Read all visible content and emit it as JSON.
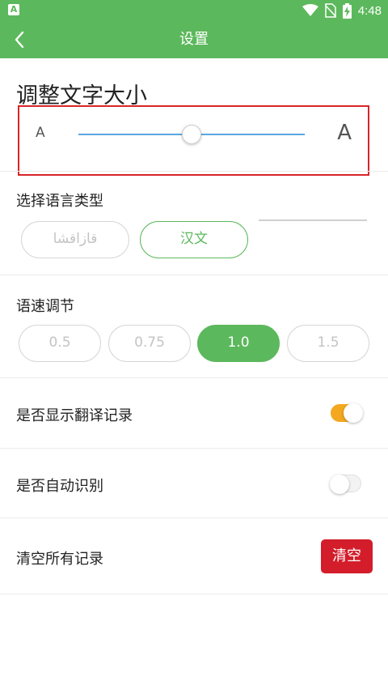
{
  "status_bar": {
    "time": "4:48",
    "app_icon_letter": "A",
    "icons": [
      "wifi-icon",
      "no-sim-icon",
      "battery-charging-icon"
    ]
  },
  "app_bar": {
    "title": "设置",
    "back_icon": "chevron-left-icon"
  },
  "font_size": {
    "title": "调整文字大小",
    "small_label": "A",
    "large_label": "A",
    "slider_value": 0.5,
    "highlight_color": "#d9252a",
    "track_color": "#5aa7de"
  },
  "language": {
    "title": "选择语言类型",
    "options": [
      {
        "label": "قازاقشا",
        "selected": false
      },
      {
        "label": "汉文",
        "selected": true
      }
    ]
  },
  "speed": {
    "title": "语速调节",
    "options": [
      {
        "label": "0.5",
        "selected": false
      },
      {
        "label": "0.75",
        "selected": false
      },
      {
        "label": "1.0",
        "selected": true
      },
      {
        "label": "1.5",
        "selected": false
      }
    ]
  },
  "settings": {
    "show_history": {
      "label": "是否显示翻译记录",
      "on": true
    },
    "auto_detect": {
      "label": "是否自动识别",
      "on": false
    },
    "clear_all": {
      "label": "清空所有记录",
      "button": "清空"
    }
  },
  "colors": {
    "primary": "#5cb85c",
    "toggle_on": "#f3a81f",
    "danger": "#d31d2b"
  }
}
